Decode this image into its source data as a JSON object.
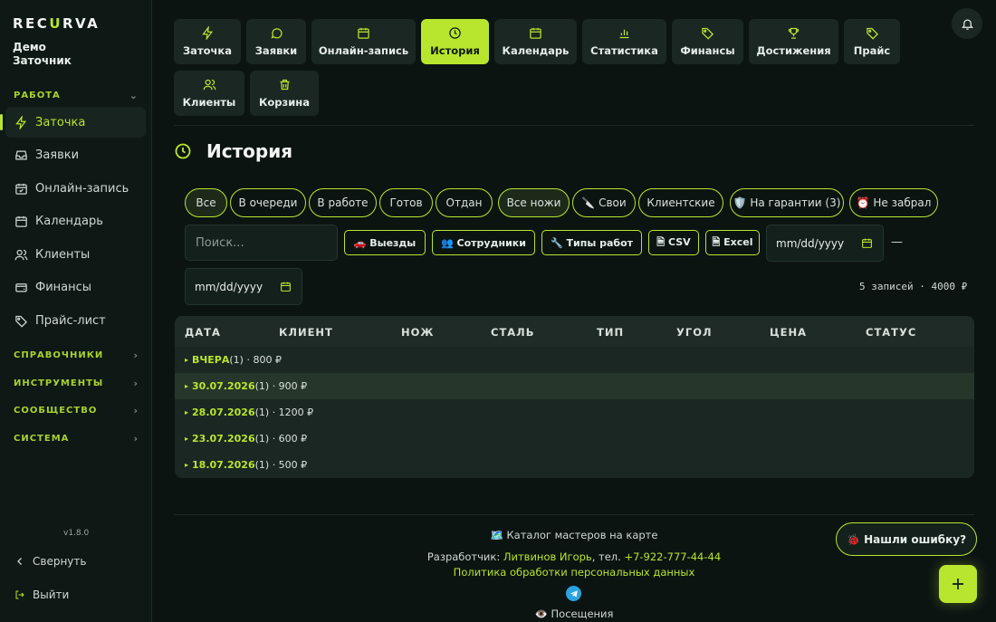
{
  "brand": {
    "logo_a": "REC",
    "logo_b": "U",
    "logo_c": "RVA"
  },
  "user": {
    "line1": "Демо",
    "line2": "Заточник"
  },
  "sidebar": {
    "section_work": "РАБОТА",
    "items": [
      {
        "label": "Заточка",
        "icon": "bolt-icon"
      },
      {
        "label": "Заявки",
        "icon": "inbox-icon"
      },
      {
        "label": "Онлайн-запись",
        "icon": "calendar-check-icon"
      },
      {
        "label": "Календарь",
        "icon": "calendar-icon"
      },
      {
        "label": "Клиенты",
        "icon": "users-icon"
      },
      {
        "label": "Финансы",
        "icon": "wallet-icon"
      },
      {
        "label": "Прайс-лист",
        "icon": "tag-icon"
      }
    ],
    "sections": [
      "СПРАВОЧНИКИ",
      "ИНСТРУМЕНТЫ",
      "СООБЩЕСТВО",
      "СИСТЕМА"
    ],
    "version": "v1.8.0",
    "collapse": "Свернуть",
    "logout": "Выйти"
  },
  "tabs": [
    "Заточка",
    "Заявки",
    "Онлайн-запись",
    "История",
    "Календарь",
    "Статистика",
    "Финансы",
    "Достижения",
    "Прайс",
    "Клиенты",
    "Корзина"
  ],
  "page": {
    "title": "История"
  },
  "filters": [
    "Все",
    "В очереди",
    "В работе",
    "Готов",
    "Отдан",
    "Все ножи",
    "🔪 Свои",
    "Клиентские",
    "🛡️ На гарантии (3)",
    "⏰ Не забрал"
  ],
  "search": {
    "placeholder": "Поиск..."
  },
  "tools": [
    "🚗 Выезды",
    "👥 Сотрудники",
    "🔧 Типы работ",
    "🗎 CSV",
    "🗎 Excel"
  ],
  "date_from": "mm/dd/yyyy",
  "date_to": "mm/dd/yyyy",
  "dash": "—",
  "summary": "5 записей · 4000 ₽",
  "table": {
    "headers": [
      "ДАТА",
      "КЛИЕНТ",
      "НОЖ",
      "СТАЛЬ",
      "ТИП",
      "УГОЛ",
      "ЦЕНА",
      "СТАТУС"
    ],
    "groups": [
      {
        "date": "ВЧЕРА",
        "info": " (1) · 800 ₽"
      },
      {
        "date": "30.07.2026",
        "info": " (1) · 900 ₽"
      },
      {
        "date": "28.07.2026",
        "info": " (1) · 1200 ₽"
      },
      {
        "date": "23.07.2026",
        "info": " (1) · 600 ₽"
      },
      {
        "date": "18.07.2026",
        "info": " (1) · 500 ₽"
      }
    ]
  },
  "footer": {
    "catalog": "🗺️ Каталог мастеров на карте",
    "dev_prefix": "Разработчик: ",
    "dev_name": "Литвинов Игорь",
    "dev_phone_prefix": ", тел. ",
    "dev_phone": "+7-922-777-44-44",
    "privacy": "Политика обработки персональных данных",
    "visits": "👁️ Посещения"
  },
  "bug_button": "🐞 Нашли ошибку?",
  "colors": {
    "accent": "#b8e62e",
    "bg": "#0c1412",
    "panel": "#1b2723"
  }
}
